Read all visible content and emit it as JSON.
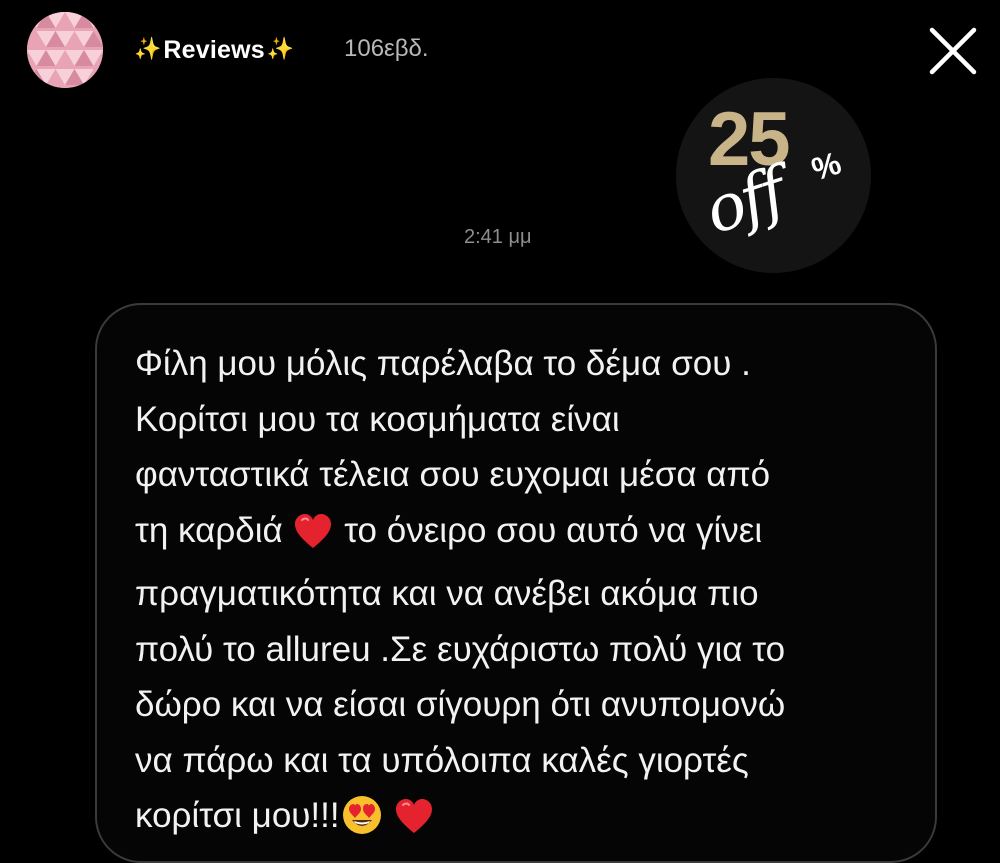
{
  "header": {
    "username_left_emoji": "✨",
    "username": "Reviews",
    "username_right_emoji": "✨",
    "time_ago": "106εβδ.",
    "close_icon": "close-icon",
    "avatar_icon": "avatar"
  },
  "sticker": {
    "number": "25",
    "percent": "%",
    "off": "off"
  },
  "message": {
    "timestamp": "2:41 μμ",
    "lines": [
      "Φίλη μου μόλις παρέλαβα το δέμα σου .",
      "Κορίτσι μου τα κοσμήματα είναι",
      "φανταστικά τέλεια σου ευχομαι μέσα από",
      "τη καρδιά",
      "το όνειρο σου αυτό να γίνει",
      "πραγματικότητα και να ανέβει ακόμα πιο",
      "πολύ το allureu .Σε ευχάριστω πολύ για το",
      "δώρο και να είσαι σίγουρη ότι ανυπομονώ",
      "να πάρω και τα υπόλοιπα καλές γιορτές",
      "κορίτσι μου!!!"
    ],
    "emojis": [
      "red-heart-icon",
      "heart-eyes-face-icon",
      "red-heart-icon"
    ]
  },
  "colors": {
    "background": "#000000",
    "bubble_border": "#3a3a3a",
    "sticker_gold": "#c9b489",
    "sparkle": "#f6c642",
    "avatar_pink": "#e8a9b8"
  }
}
